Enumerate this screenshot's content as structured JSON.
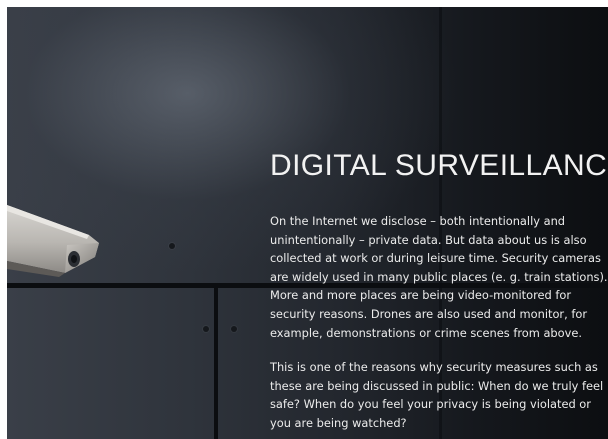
{
  "page": {
    "title": "DIGITAL SURVEILLANCE",
    "paragraphs": [
      "On the Internet we disclose – both intentionally and unintentionally – private data. But data about us is also collected at work or during leisure time. Security cameras are widely used in many public places (e. g. train stations). More and more places are being video-monitored for security reasons. Drones are also used and monitor, for example, demonstrations or crime scenes from above.",
      "This is one of the reasons why security measures such as these are being discussed in public: When do we truly feel safe? When do you feel your privacy is being violated or you are being watched?"
    ]
  },
  "hero_image": {
    "icon": "security-camera-icon"
  },
  "colors": {
    "background_dark": "#15181d",
    "text": "#ececec"
  }
}
